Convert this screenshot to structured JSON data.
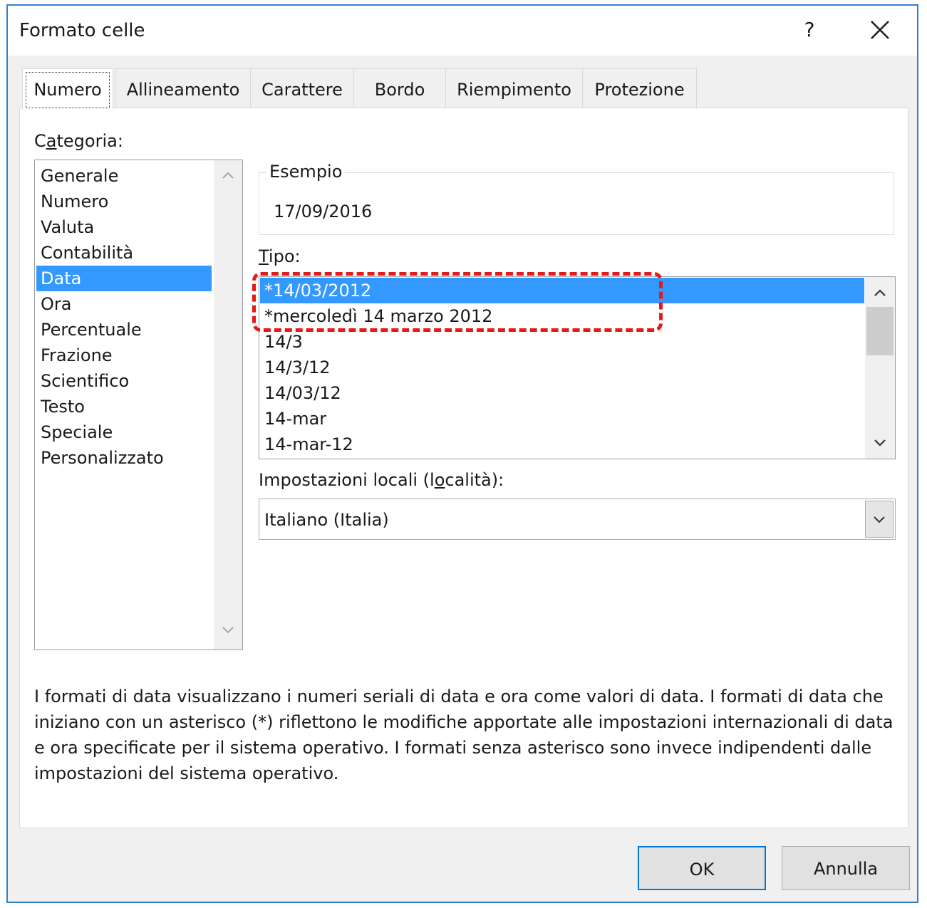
{
  "window": {
    "title": "Formato celle",
    "help_label": "?"
  },
  "tabs": [
    {
      "label": "Numero",
      "active": true
    },
    {
      "label": "Allineamento"
    },
    {
      "label": "Carattere"
    },
    {
      "label": "Bordo"
    },
    {
      "label": "Riempimento"
    },
    {
      "label": "Protezione"
    }
  ],
  "category": {
    "label_pre": "C",
    "label_accel": "a",
    "label_post": "tegoria:",
    "items": [
      "Generale",
      "Numero",
      "Valuta",
      "Contabilità",
      "Data",
      "Ora",
      "Percentuale",
      "Frazione",
      "Scientifico",
      "Testo",
      "Speciale",
      "Personalizzato"
    ],
    "selected": "Data"
  },
  "sample": {
    "legend": "Esempio",
    "value": "17/09/2016"
  },
  "type": {
    "label_accel": "T",
    "label_post": "ipo:",
    "items": [
      "*14/03/2012",
      "*mercoledì 14 marzo 2012",
      "14/3",
      "14/3/12",
      "14/03/12",
      "14-mar",
      "14-mar-12"
    ],
    "selected": "*14/03/2012"
  },
  "locale": {
    "label_pre": "Impostazioni locali (l",
    "label_accel": "o",
    "label_post": "calità):",
    "value": "Italiano (Italia)"
  },
  "description": "I formati di data visualizzano i numeri seriali di data e ora come valori di data. I formati di data che iniziano con un asterisco (*) riflettono le modifiche apportate alle impostazioni internazionali di data e ora specificate per il sistema operativo. I formati senza asterisco sono invece indipendenti dalle impostazioni del sistema operativo.",
  "buttons": {
    "ok": "OK",
    "cancel": "Annulla"
  },
  "colors": {
    "selection": "#3399ff",
    "annotation": "#e31b1b",
    "window_border": "#2f7fcf"
  },
  "icons": {
    "close": "close-icon",
    "scroll_up": "chevron-up-icon",
    "scroll_down": "chevron-down-icon",
    "dropdown": "chevron-down-icon"
  }
}
